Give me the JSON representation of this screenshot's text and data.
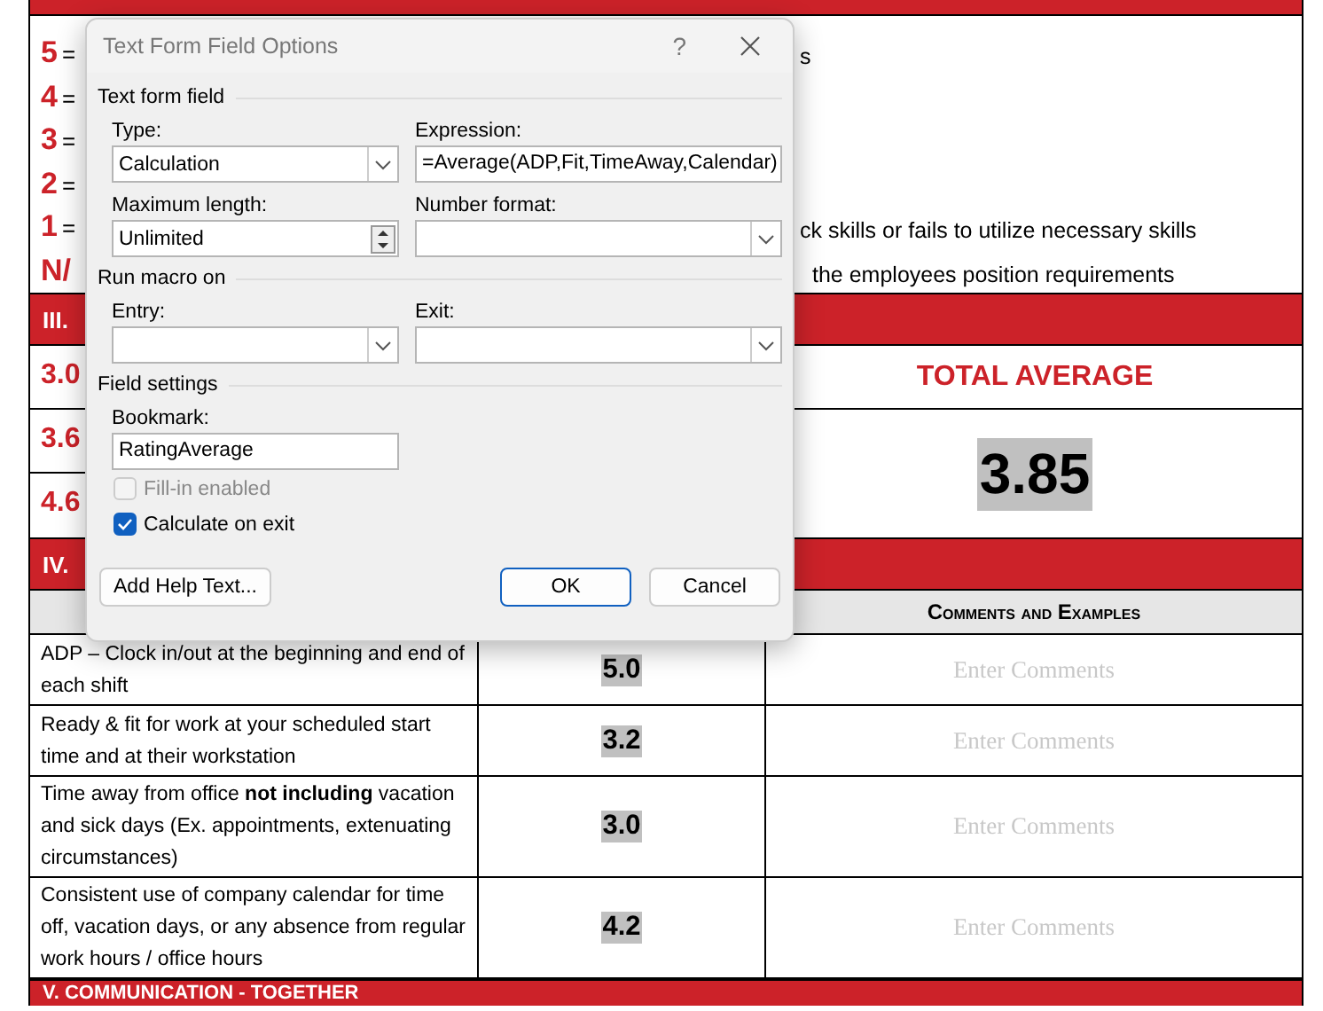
{
  "document": {
    "scale": [
      {
        "score": "5",
        "separator": "=",
        "tail": "s"
      },
      {
        "score": "4",
        "separator": "="
      },
      {
        "score": "3",
        "separator": "="
      },
      {
        "score": "2",
        "separator": "="
      },
      {
        "score": "1",
        "separator": "=",
        "tail": "ck skills or fails to utilize necessary skills"
      },
      {
        "score": "N/",
        "tail": "the employees position requirements"
      }
    ],
    "section_3": {
      "heading": "III.",
      "scores": [
        "3.0",
        "3.6",
        "4.6"
      ],
      "total_label": "TOTAL AVERAGE",
      "total_value": "3.85"
    },
    "section_4": {
      "heading": "IV.",
      "comments_header": "Comments and Examples",
      "rows": [
        {
          "text": "ADP – Clock in/out at the beginning and end of each shift",
          "rating": "5.0",
          "comments_placeholder": "Enter Comments"
        },
        {
          "text": "Ready & fit for work at your scheduled start time and at their workstation",
          "rating": "3.2",
          "comments_placeholder": "Enter Comments"
        },
        {
          "text": "Time away from office **not including** vacation and sick days (Ex. appointments, extenuating circumstances)",
          "rating": "3.0",
          "comments_placeholder": "Enter Comments"
        },
        {
          "text": "Consistent use of company calendar for time off, vacation days, or any absence from regular work hours / office hours",
          "rating": "4.2",
          "comments_placeholder": "Enter Comments"
        }
      ]
    },
    "section_5": {
      "heading": "V. COMMUNICATION - TOGETHER"
    }
  },
  "dialog": {
    "title": "Text Form Field Options",
    "help": "?",
    "text_form_field": {
      "legend": "Text form field",
      "type": {
        "label": "Type:",
        "value": "Calculation"
      },
      "expression": {
        "label": "Expression:",
        "value": "=Average(ADP,Fit,TimeAway,Calendar)"
      },
      "max_length": {
        "label": "Maximum length:",
        "value": "Unlimited"
      },
      "number_format": {
        "label": "Number format:"
      }
    },
    "run_macro": {
      "legend": "Run macro on",
      "entry": {
        "label": "Entry:"
      },
      "exit": {
        "label": "Exit:"
      }
    },
    "field_settings": {
      "legend": "Field settings",
      "bookmark": {
        "label": "Bookmark:",
        "value": "RatingAverage"
      },
      "checkboxes": [
        {
          "label": "Fill-in enabled",
          "checked": false,
          "disabled": true
        },
        {
          "label": "Calculate on exit",
          "checked": true,
          "disabled": false
        }
      ]
    },
    "buttons": [
      {
        "label": "Add Help Text...",
        "kind": "secondary"
      },
      {
        "label": "OK",
        "kind": "default"
      },
      {
        "label": "Cancel",
        "kind": "secondary"
      }
    ]
  }
}
